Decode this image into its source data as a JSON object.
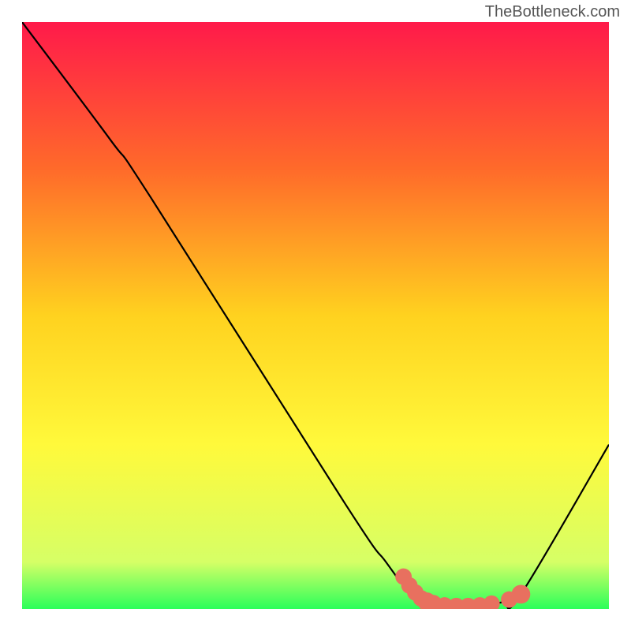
{
  "watermark": "TheBottleneck.com",
  "chart_data": {
    "type": "line",
    "title": "",
    "xlabel": "",
    "ylabel": "",
    "xlim": [
      0,
      100
    ],
    "ylim": [
      0,
      100
    ],
    "gradient_stops": [
      {
        "offset": 0,
        "color": "#ff1a4a"
      },
      {
        "offset": 25,
        "color": "#ff6a2a"
      },
      {
        "offset": 50,
        "color": "#ffd21f"
      },
      {
        "offset": 72,
        "color": "#fff93b"
      },
      {
        "offset": 92,
        "color": "#d6ff66"
      },
      {
        "offset": 100,
        "color": "#2bff5a"
      }
    ],
    "curve": [
      {
        "x": 0,
        "y": 100
      },
      {
        "x": 15,
        "y": 80
      },
      {
        "x": 22,
        "y": 70
      },
      {
        "x": 55,
        "y": 18
      },
      {
        "x": 62,
        "y": 8
      },
      {
        "x": 66,
        "y": 3
      },
      {
        "x": 70,
        "y": 0.8
      },
      {
        "x": 74,
        "y": 0.5
      },
      {
        "x": 78,
        "y": 0.6
      },
      {
        "x": 82,
        "y": 1.2
      },
      {
        "x": 85,
        "y": 2.5
      },
      {
        "x": 100,
        "y": 28
      }
    ],
    "markers": [
      {
        "x": 65,
        "y": 5.5,
        "r": 1.4
      },
      {
        "x": 66,
        "y": 4.0,
        "r": 1.4
      },
      {
        "x": 67,
        "y": 2.8,
        "r": 1.4
      },
      {
        "x": 68,
        "y": 1.8,
        "r": 1.4
      },
      {
        "x": 69,
        "y": 1.2,
        "r": 1.6
      },
      {
        "x": 70,
        "y": 0.8,
        "r": 1.6
      },
      {
        "x": 72,
        "y": 0.6,
        "r": 1.4
      },
      {
        "x": 74,
        "y": 0.5,
        "r": 1.4
      },
      {
        "x": 76,
        "y": 0.5,
        "r": 1.4
      },
      {
        "x": 78,
        "y": 0.6,
        "r": 1.4
      },
      {
        "x": 80,
        "y": 0.9,
        "r": 1.4
      },
      {
        "x": 83,
        "y": 1.6,
        "r": 1.4
      },
      {
        "x": 85,
        "y": 2.5,
        "r": 1.6
      }
    ],
    "marker_color": "#e8705f"
  }
}
